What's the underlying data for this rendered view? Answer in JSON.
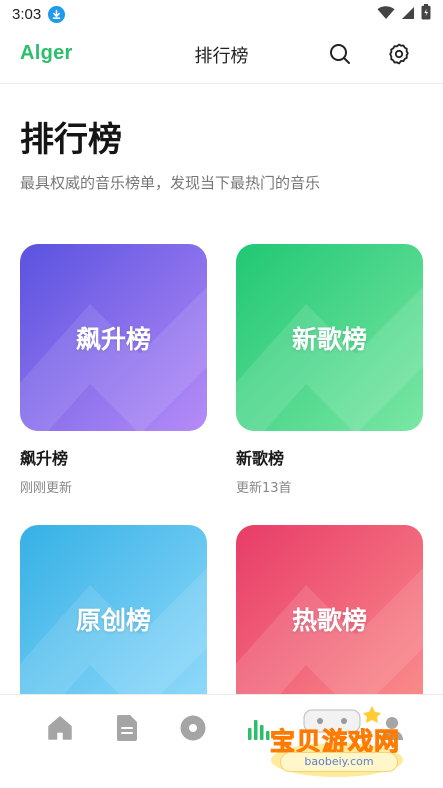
{
  "status_bar": {
    "time": "3:03",
    "icons": [
      "download-badge-icon",
      "wifi-icon",
      "signal-icon",
      "battery-icon"
    ]
  },
  "app_bar": {
    "brand": "Alger",
    "title": "排行榜",
    "actions": [
      "search-icon",
      "gear-icon"
    ]
  },
  "page": {
    "heading": "排行榜",
    "subtitle": "最具权威的音乐榜单，发现当下最热门的音乐"
  },
  "charts": [
    {
      "cover_label": "飙升榜",
      "title": "飙升榜",
      "subtitle": "刚刚更新",
      "color_from": "#5b55e0",
      "color_to": "#b58cf7"
    },
    {
      "cover_label": "新歌榜",
      "title": "新歌榜",
      "subtitle": "更新13首",
      "color_from": "#22c777",
      "color_to": "#77e6a0"
    },
    {
      "cover_label": "原创榜",
      "title": "",
      "subtitle": "",
      "color_from": "#38b3e6",
      "color_to": "#8fd9fb"
    },
    {
      "cover_label": "热歌榜",
      "title": "",
      "subtitle": "",
      "color_from": "#e83f6a",
      "color_to": "#f98b8b"
    }
  ],
  "bottom_nav": {
    "items": [
      "home-icon",
      "document-icon",
      "disc-icon",
      "chart-bars-icon",
      "profile-icon"
    ],
    "active": "chart-bars-icon"
  },
  "colors": {
    "brand": "#2bbf6b",
    "nav_inactive": "#a5a5a5",
    "nav_active": "#2bbf6b"
  },
  "watermark": {
    "title": "宝贝游戏网",
    "url": "baobeiy.com"
  }
}
